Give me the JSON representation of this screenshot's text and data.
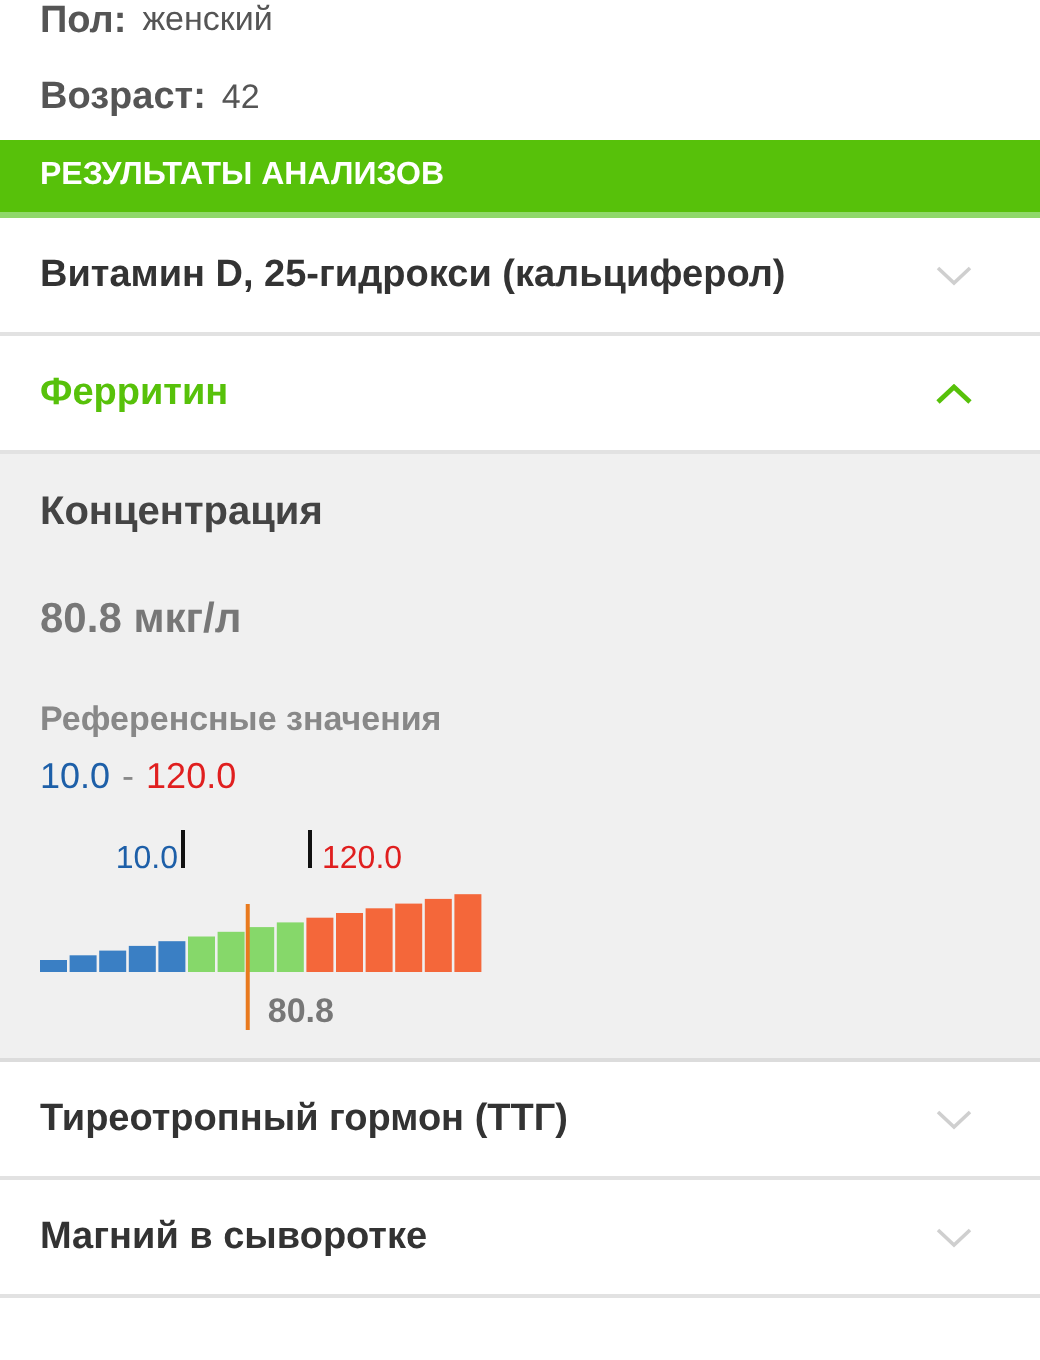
{
  "patient": {
    "fields": [
      {
        "label": "Пол:",
        "value": "женский"
      },
      {
        "label": "Возраст:",
        "value": "42"
      }
    ]
  },
  "section_header": "РЕЗУЛЬТАТЫ АНАЛИЗОВ",
  "tests": [
    {
      "name": "Витамин D, 25-гидрокси (кальциферол)",
      "expanded": false
    },
    {
      "name": "Ферритин",
      "expanded": true,
      "detail": {
        "metric": "Концентрация",
        "value": "80.8 мкг/л",
        "reference_label": "Референсные значения",
        "range_low": "10.0",
        "range_separator": "-",
        "range_high": "120.0",
        "gauge": {
          "low_label": "10.0",
          "high_label": "120.0",
          "marker_label": "80.8",
          "level": 0.47
        }
      }
    },
    {
      "name": "Тиреотропный гормон (ТТГ)",
      "expanded": false
    },
    {
      "name": "Магний в сыворотке",
      "expanded": false
    }
  ]
}
